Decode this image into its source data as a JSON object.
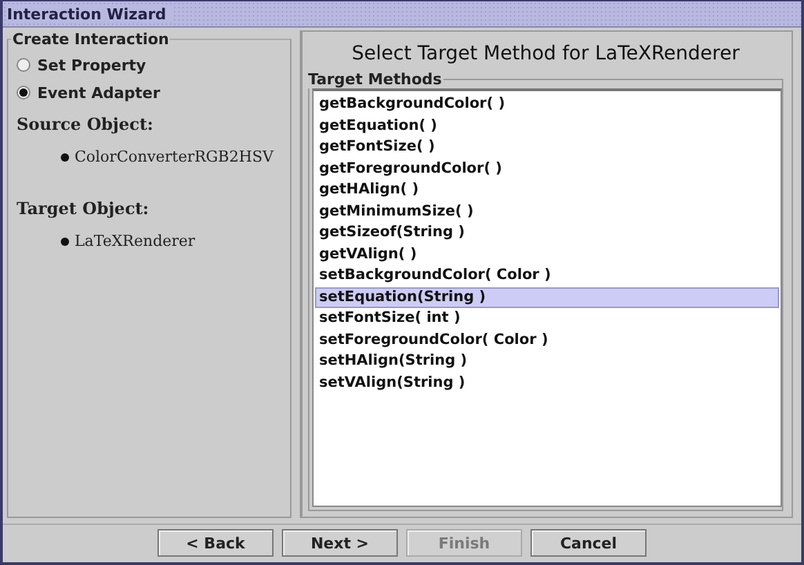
{
  "window": {
    "title": "Interaction Wizard"
  },
  "left_panel": {
    "group_title": "Create Interaction",
    "options": [
      {
        "label": "Set Property",
        "selected": false
      },
      {
        "label": "Event Adapter",
        "selected": true
      }
    ],
    "source_label": "Source Object:",
    "source_value": "ColorConverterRGB2HSV",
    "target_label": "Target Object:",
    "target_value": "LaTeXRenderer"
  },
  "right_panel": {
    "heading": "Select Target Method for LaTeXRenderer",
    "group_title": "Target Methods",
    "methods": [
      {
        "label": "getBackgroundColor( )",
        "selected": false
      },
      {
        "label": "getEquation( )",
        "selected": false
      },
      {
        "label": "getFontSize( )",
        "selected": false
      },
      {
        "label": "getForegroundColor( )",
        "selected": false
      },
      {
        "label": "getHAlign( )",
        "selected": false
      },
      {
        "label": "getMinimumSize( )",
        "selected": false
      },
      {
        "label": "getSizeof(String )",
        "selected": false
      },
      {
        "label": "getVAlign( )",
        "selected": false
      },
      {
        "label": "setBackgroundColor( Color )",
        "selected": false
      },
      {
        "label": "setEquation(String )",
        "selected": true
      },
      {
        "label": "setFontSize( int )",
        "selected": false
      },
      {
        "label": "setForegroundColor( Color )",
        "selected": false
      },
      {
        "label": "setHAlign(String )",
        "selected": false
      },
      {
        "label": "setVAlign(String )",
        "selected": false
      }
    ]
  },
  "buttons": [
    {
      "label": "< Back",
      "disabled": false
    },
    {
      "label": "Next >",
      "disabled": false
    },
    {
      "label": "Finish",
      "disabled": true
    },
    {
      "label": "Cancel",
      "disabled": false
    }
  ]
}
